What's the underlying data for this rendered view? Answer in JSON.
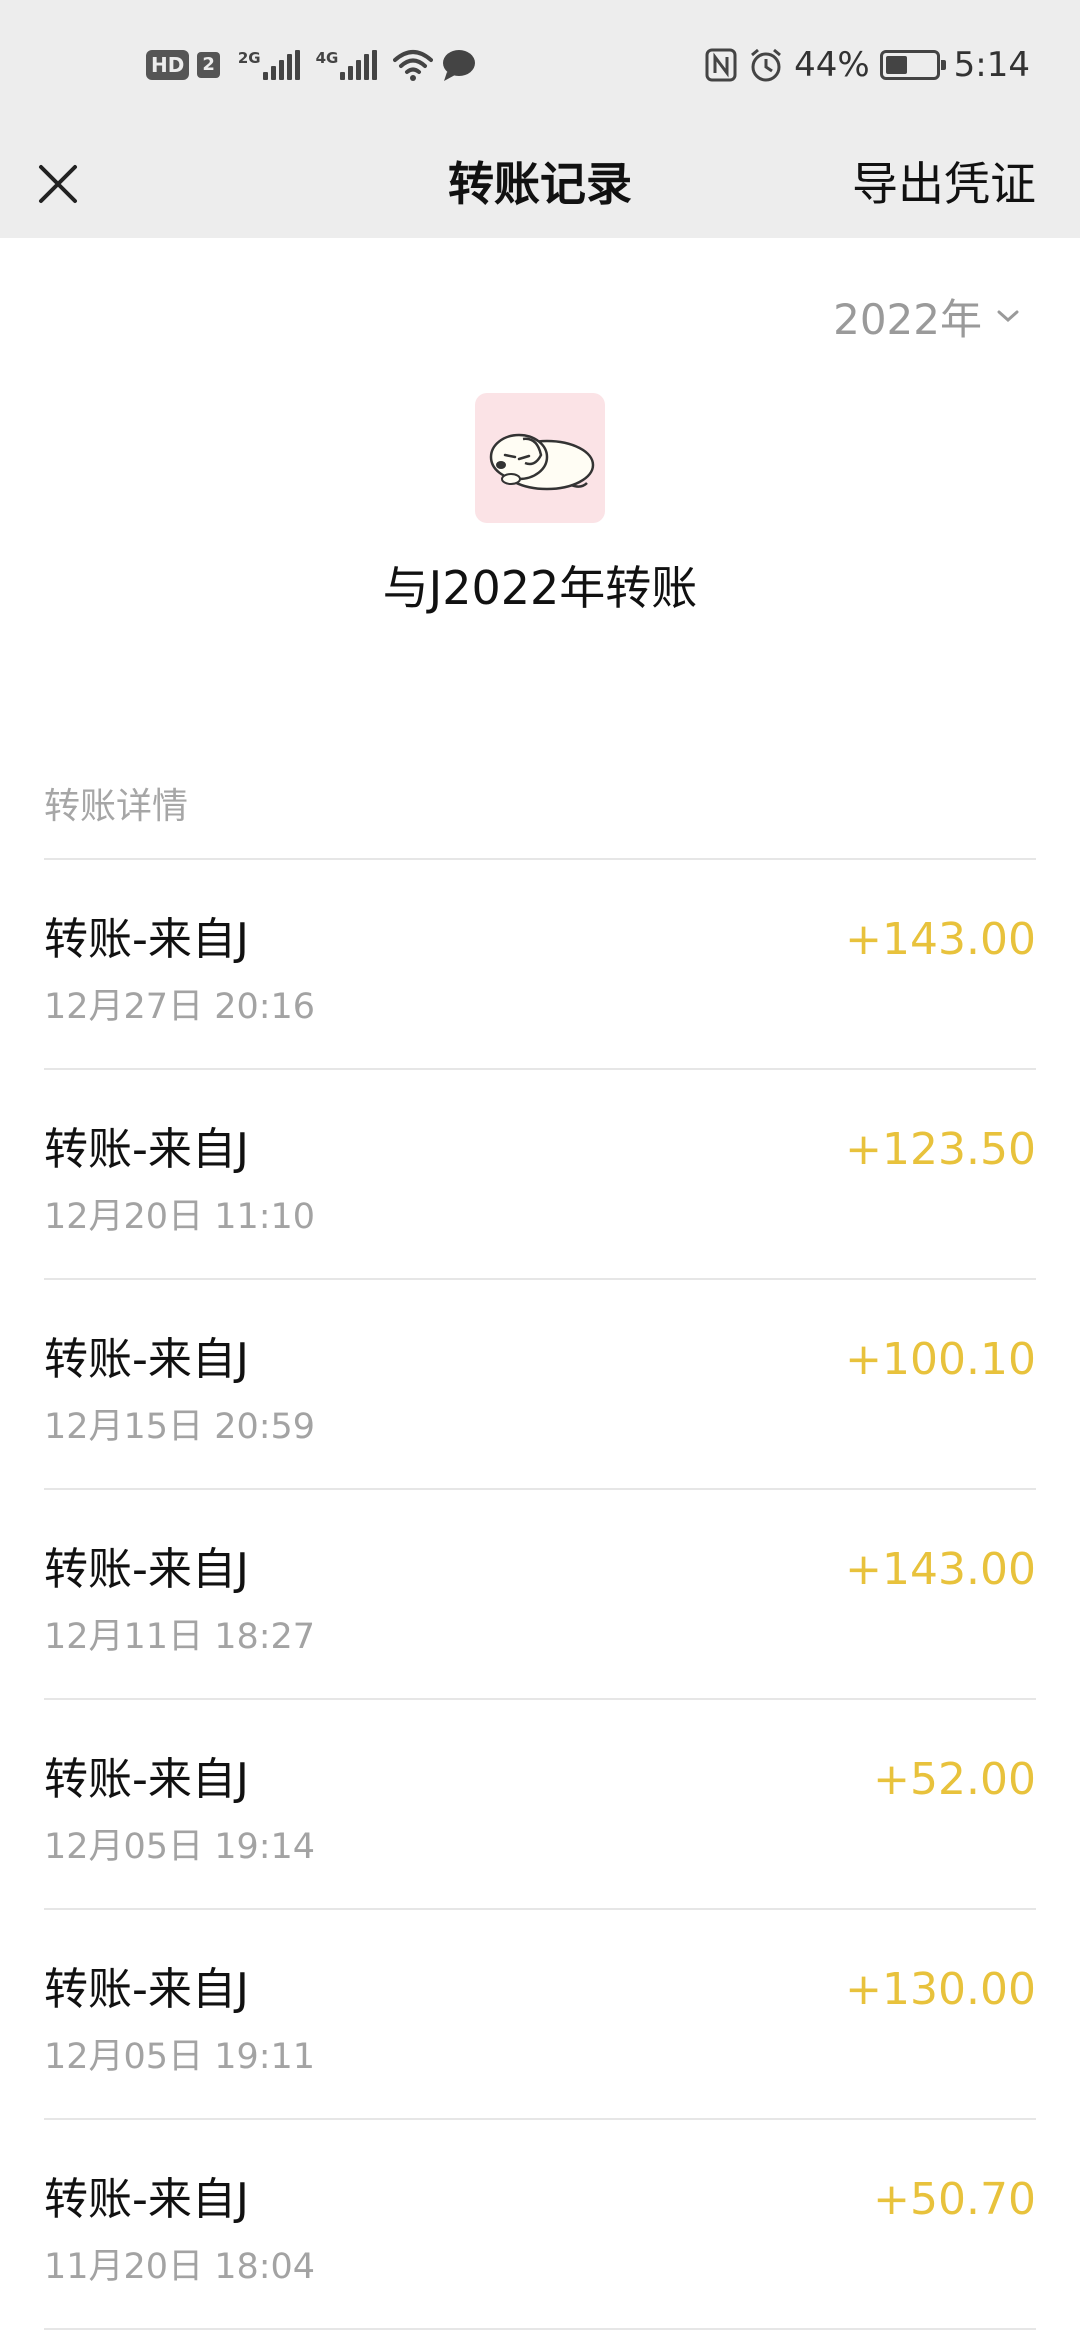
{
  "status_bar": {
    "hd_label": "HD",
    "sim_number": "2",
    "net1_label": "2G",
    "net2_label": "4G",
    "battery_percent": "44%",
    "battery_level": 0.44,
    "time": "5:14",
    "icons": [
      "wifi-icon",
      "message-icon",
      "nfc-icon",
      "alarm-icon",
      "battery-icon"
    ]
  },
  "header": {
    "title": "转账记录",
    "export_label": "导出凭证",
    "close_icon": "close-icon"
  },
  "year_selector": {
    "value": "2022年",
    "icon": "chevron-down-icon"
  },
  "summary": {
    "title": "与J2022年转账",
    "avatar_icon": "sleeping-dog-avatar"
  },
  "section": {
    "label": "转账详情"
  },
  "colors": {
    "header_bg": "#ededed",
    "amount": "#e8c23c",
    "secondary_text": "#a3a3a3"
  },
  "transactions": [
    {
      "title": "转账-来自J",
      "time": "12月27日 20:16",
      "amount": "+143.00"
    },
    {
      "title": "转账-来自J",
      "time": "12月20日 11:10",
      "amount": "+123.50"
    },
    {
      "title": "转账-来自J",
      "time": "12月15日 20:59",
      "amount": "+100.10"
    },
    {
      "title": "转账-来自J",
      "time": "12月11日 18:27",
      "amount": "+143.00"
    },
    {
      "title": "转账-来自J",
      "time": "12月05日 19:14",
      "amount": "+52.00"
    },
    {
      "title": "转账-来自J",
      "time": "12月05日 19:11",
      "amount": "+130.00"
    },
    {
      "title": "转账-来自J",
      "time": "11月20日 18:04",
      "amount": "+50.70"
    }
  ]
}
